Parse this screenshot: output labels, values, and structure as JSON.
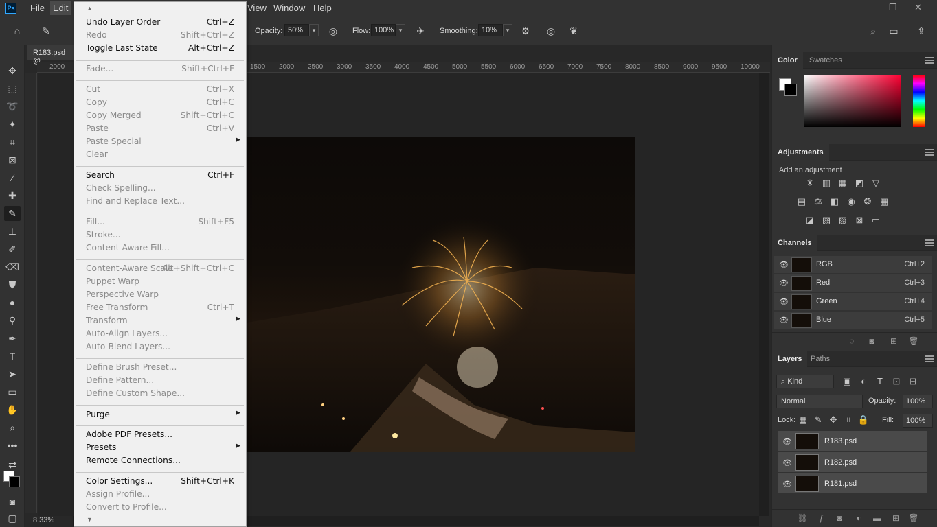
{
  "app": {
    "logo_text": "Ps",
    "menus": [
      "File",
      "Edit",
      "View",
      "Window",
      "Help"
    ],
    "window_controls": {
      "minimize": "—",
      "restore": "❐",
      "close": "✕"
    }
  },
  "options_bar": {
    "opacity_label": "Opacity:",
    "opacity_value": "50%",
    "flow_label": "Flow:",
    "flow_value": "100%",
    "smoothing_label": "Smoothing:",
    "smoothing_value": "10%"
  },
  "document": {
    "tab_title": "R183.psd @",
    "zoom": "8.33%",
    "ruler_left_label": "2000",
    "ruler_ticks": [
      "1500",
      "2000",
      "2500",
      "3000",
      "3500",
      "4000",
      "4500",
      "5000",
      "5500",
      "6000",
      "6500",
      "7000",
      "7500",
      "8000",
      "8500",
      "9000",
      "9500",
      "10000"
    ]
  },
  "edit_menu": {
    "groups": [
      [
        {
          "label": "Undo Layer Order",
          "shortcut": "Ctrl+Z",
          "enabled": true
        },
        {
          "label": "Redo",
          "shortcut": "Shift+Ctrl+Z",
          "enabled": false
        },
        {
          "label": "Toggle Last State",
          "shortcut": "Alt+Ctrl+Z",
          "enabled": true
        }
      ],
      [
        {
          "label": "Fade...",
          "shortcut": "Shift+Ctrl+F",
          "enabled": false
        }
      ],
      [
        {
          "label": "Cut",
          "shortcut": "Ctrl+X",
          "enabled": false
        },
        {
          "label": "Copy",
          "shortcut": "Ctrl+C",
          "enabled": false
        },
        {
          "label": "Copy Merged",
          "shortcut": "Shift+Ctrl+C",
          "enabled": false
        },
        {
          "label": "Paste",
          "shortcut": "Ctrl+V",
          "enabled": false
        },
        {
          "label": "Paste Special",
          "shortcut": "",
          "enabled": false,
          "submenu": true
        },
        {
          "label": "Clear",
          "shortcut": "",
          "enabled": false
        }
      ],
      [
        {
          "label": "Search",
          "shortcut": "Ctrl+F",
          "enabled": true
        },
        {
          "label": "Check Spelling...",
          "shortcut": "",
          "enabled": false
        },
        {
          "label": "Find and Replace Text...",
          "shortcut": "",
          "enabled": false
        }
      ],
      [
        {
          "label": "Fill...",
          "shortcut": "Shift+F5",
          "enabled": false
        },
        {
          "label": "Stroke...",
          "shortcut": "",
          "enabled": false
        },
        {
          "label": "Content-Aware Fill...",
          "shortcut": "",
          "enabled": false
        }
      ],
      [
        {
          "label": "Content-Aware Scale",
          "shortcut": "Alt+Shift+Ctrl+C",
          "enabled": false
        },
        {
          "label": "Puppet Warp",
          "shortcut": "",
          "enabled": false
        },
        {
          "label": "Perspective Warp",
          "shortcut": "",
          "enabled": false
        },
        {
          "label": "Free Transform",
          "shortcut": "Ctrl+T",
          "enabled": false
        },
        {
          "label": "Transform",
          "shortcut": "",
          "enabled": false,
          "submenu": true
        },
        {
          "label": "Auto-Align Layers...",
          "shortcut": "",
          "enabled": false
        },
        {
          "label": "Auto-Blend Layers...",
          "shortcut": "",
          "enabled": false
        }
      ],
      [
        {
          "label": "Define Brush Preset...",
          "shortcut": "",
          "enabled": false
        },
        {
          "label": "Define Pattern...",
          "shortcut": "",
          "enabled": false
        },
        {
          "label": "Define Custom Shape...",
          "shortcut": "",
          "enabled": false
        }
      ],
      [
        {
          "label": "Purge",
          "shortcut": "",
          "enabled": true,
          "submenu": true
        }
      ],
      [
        {
          "label": "Adobe PDF Presets...",
          "shortcut": "",
          "enabled": true
        },
        {
          "label": "Presets",
          "shortcut": "",
          "enabled": true,
          "submenu": true
        },
        {
          "label": "Remote Connections...",
          "shortcut": "",
          "enabled": true
        }
      ],
      [
        {
          "label": "Color Settings...",
          "shortcut": "Shift+Ctrl+K",
          "enabled": true
        },
        {
          "label": "Assign Profile...",
          "shortcut": "",
          "enabled": false
        },
        {
          "label": "Convert to Profile...",
          "shortcut": "",
          "enabled": false
        }
      ]
    ]
  },
  "color_panel": {
    "tabs": [
      "Color",
      "Swatches"
    ]
  },
  "adjustments_panel": {
    "tab": "Adjustments",
    "hint": "Add an adjustment"
  },
  "channels_panel": {
    "tab": "Channels",
    "rows": [
      {
        "name": "RGB",
        "shortcut": "Ctrl+2"
      },
      {
        "name": "Red",
        "shortcut": "Ctrl+3"
      },
      {
        "name": "Green",
        "shortcut": "Ctrl+4"
      },
      {
        "name": "Blue",
        "shortcut": "Ctrl+5"
      }
    ]
  },
  "layers_panel": {
    "tabs": [
      "Layers",
      "Paths"
    ],
    "kind_label": "Kind",
    "blend_mode": "Normal",
    "opacity_label": "Opacity:",
    "opacity_value": "100%",
    "lock_label": "Lock:",
    "fill_label": "Fill:",
    "fill_value": "100%",
    "layers": [
      {
        "name": "R183.psd"
      },
      {
        "name": "R182.psd"
      },
      {
        "name": "R181.psd"
      }
    ]
  }
}
